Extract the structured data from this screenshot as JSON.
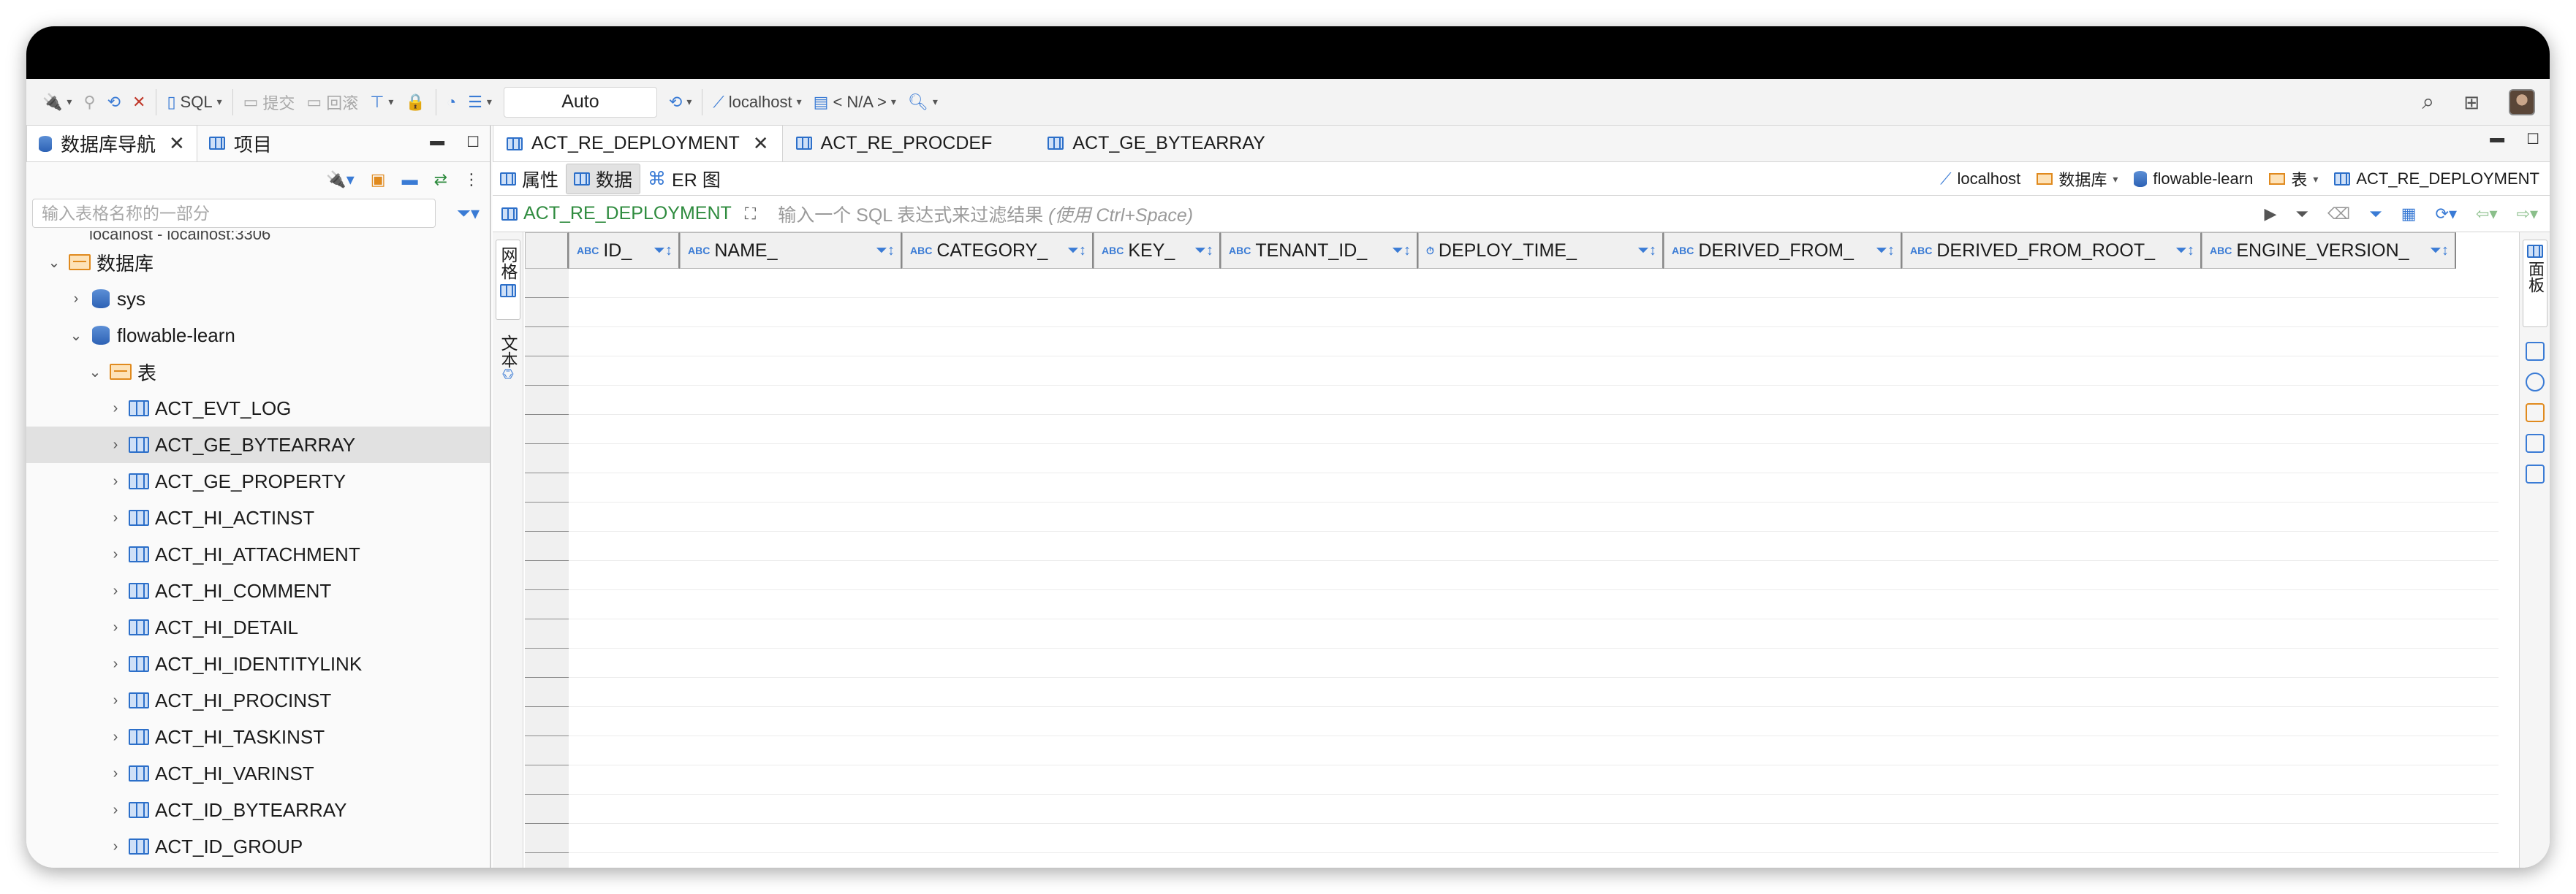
{
  "toolbar": {
    "sql_label": "SQL",
    "commit_label": "提交",
    "rollback_label": "回滚",
    "transaction_mode": "Auto",
    "connection": "localhost",
    "schema": "< N/A >"
  },
  "left_panel": {
    "tabs": [
      {
        "label": "数据库导航"
      },
      {
        "label": "项目"
      }
    ],
    "search_placeholder": "输入表格名称的一部分",
    "partial_row": "localhost - localhost:3306",
    "tree": [
      {
        "label": "数据库"
      },
      {
        "label": "sys"
      },
      {
        "label": "flowable-learn"
      },
      {
        "label": "表"
      }
    ],
    "tables": [
      "ACT_EVT_LOG",
      "ACT_GE_BYTEARRAY",
      "ACT_GE_PROPERTY",
      "ACT_HI_ACTINST",
      "ACT_HI_ATTACHMENT",
      "ACT_HI_COMMENT",
      "ACT_HI_DETAIL",
      "ACT_HI_IDENTITYLINK",
      "ACT_HI_PROCINST",
      "ACT_HI_TASKINST",
      "ACT_HI_VARINST",
      "ACT_ID_BYTEARRAY",
      "ACT_ID_GROUP"
    ],
    "selected_table": "ACT_GE_BYTEARRAY"
  },
  "editor": {
    "tabs": [
      {
        "label": "ACT_RE_DEPLOYMENT"
      },
      {
        "label": "ACT_RE_PROCDEF"
      },
      {
        "label": "ACT_GE_BYTEARRAY"
      }
    ],
    "subtabs": [
      {
        "label": "属性"
      },
      {
        "label": "数据"
      },
      {
        "label": "ER 图"
      }
    ],
    "breadcrumbs": [
      {
        "label": "localhost"
      },
      {
        "label": "数据库"
      },
      {
        "label": "flowable-learn"
      },
      {
        "label": "表"
      },
      {
        "label": "ACT_RE_DEPLOYMENT"
      }
    ],
    "filter_table": "ACT_RE_DEPLOYMENT",
    "filter_placeholder": "输入一个 SQL 表达式来过滤结果",
    "filter_hint": "(使用 Ctrl+Space)",
    "side_tabs": [
      {
        "label": "网格"
      },
      {
        "label": "文本"
      }
    ],
    "right_panel_label": "面板",
    "columns": [
      {
        "name": "ID_",
        "type": "ABC"
      },
      {
        "name": "NAME_",
        "type": "ABC"
      },
      {
        "name": "CATEGORY_",
        "type": "ABC"
      },
      {
        "name": "KEY_",
        "type": "ABC"
      },
      {
        "name": "TENANT_ID_",
        "type": "ABC"
      },
      {
        "name": "DEPLOY_TIME_",
        "type": "⏱"
      },
      {
        "name": "DERIVED_FROM_",
        "type": "ABC"
      },
      {
        "name": "DERIVED_FROM_ROOT_",
        "type": "ABC"
      },
      {
        "name": "ENGINE_VERSION_",
        "type": "ABC"
      }
    ]
  },
  "colors": {
    "accent": "#3a7bd5",
    "folder": "#e08a1e",
    "filter_table": "#2e8b3e",
    "selected_row": "#e1e1e1"
  }
}
